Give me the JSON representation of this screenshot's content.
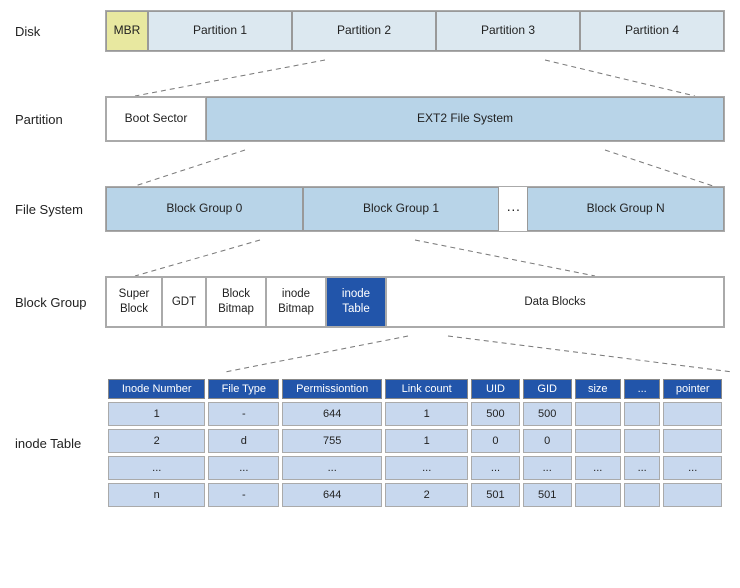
{
  "labels": {
    "disk": "Disk",
    "partition": "Partition",
    "filesystem": "File System",
    "blockgroup": "Block Group",
    "inodetable": "inode Table"
  },
  "disk": {
    "mbr": "MBR",
    "partitions": [
      "Partition 1",
      "Partition 2",
      "Partition 3",
      "Partition 4"
    ]
  },
  "partition": {
    "boot": "Boot Sector",
    "ext2": "EXT2 File System"
  },
  "filesystem": {
    "groups": [
      "Block Group 0",
      "Block Group 1",
      "···",
      "Block Group N"
    ]
  },
  "blockgroup": {
    "super": "Super Block",
    "gdt": "GDT",
    "bb": "Block Bitmap",
    "ib": "inode Bitmap",
    "it": "inode Table",
    "db": "Data Blocks"
  },
  "inode": {
    "headers": [
      "Inode Number",
      "File Type",
      "Permissiontion",
      "Link count",
      "UID",
      "GID",
      "size",
      "...",
      "pointer"
    ],
    "rows": [
      [
        "1",
        "-",
        "644",
        "1",
        "500",
        "500",
        "",
        "",
        ""
      ],
      [
        "2",
        "d",
        "755",
        "1",
        "0",
        "0",
        "",
        "",
        ""
      ],
      [
        "...",
        "...",
        "...",
        "...",
        "...",
        "...",
        "...",
        "...",
        "..."
      ],
      [
        "n",
        "-",
        "644",
        "2",
        "501",
        "501",
        "",
        "",
        ""
      ]
    ]
  }
}
